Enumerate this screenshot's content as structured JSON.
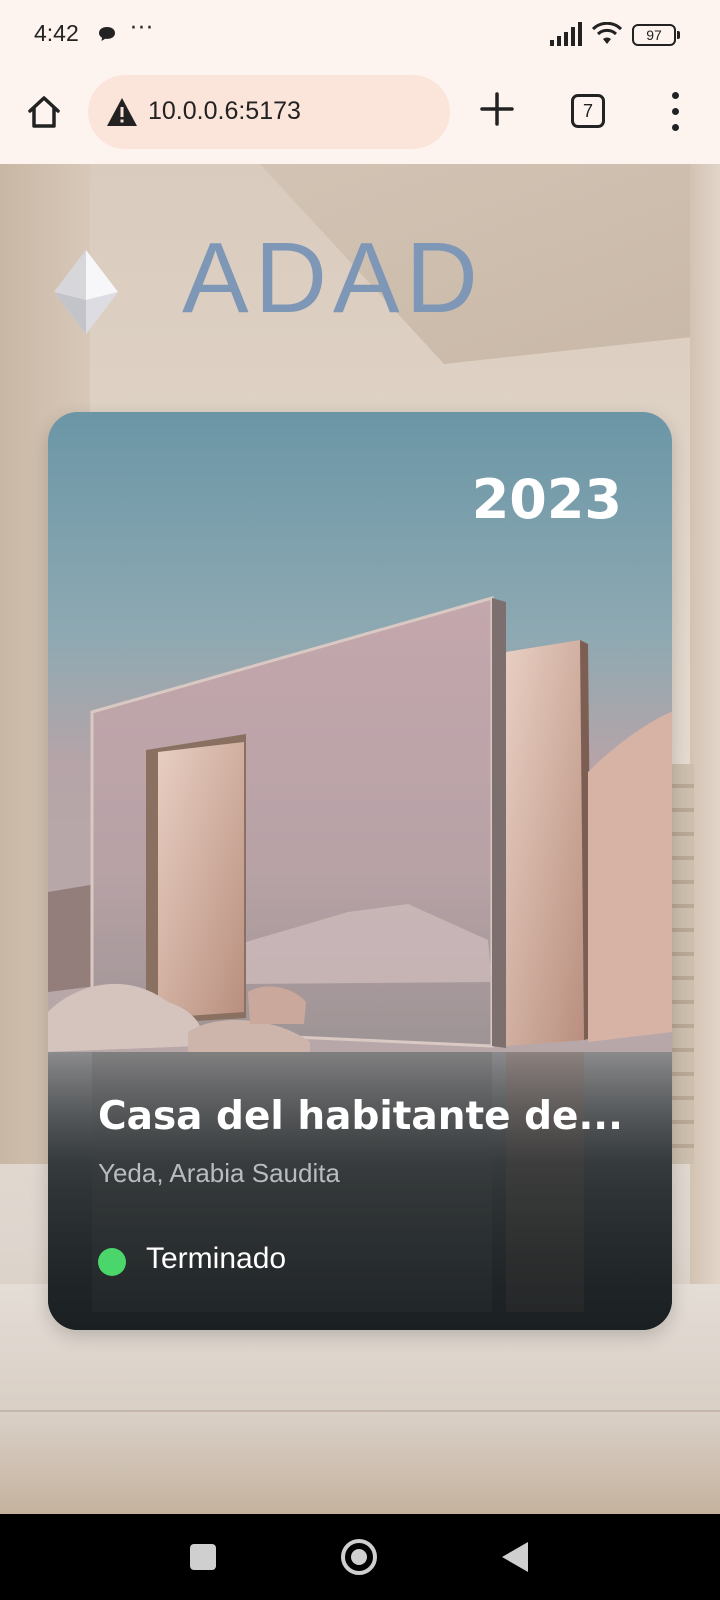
{
  "status_bar": {
    "time": "4:42",
    "overflow": "···",
    "battery": "97",
    "icons": [
      "chat-icon",
      "signal-icon",
      "wifi-icon",
      "battery-icon"
    ]
  },
  "browser": {
    "url": "10.0.0.6:5173",
    "tab_count": "7",
    "icons": [
      "home-icon",
      "warning-icon",
      "plus-icon",
      "tabs-icon",
      "kebab-menu-icon"
    ]
  },
  "site": {
    "logo_text": "ADAD",
    "logo_color": "#7e97b7"
  },
  "project_card": {
    "year": "2023",
    "title": "Casa del habitante de...",
    "location": "Yeda, Arabia Saudita",
    "status": "Terminado",
    "status_color": "#4ad66a"
  },
  "nav_bar": {
    "icons": [
      "recent-apps-icon",
      "home-circle-icon",
      "back-triangle-icon"
    ]
  }
}
